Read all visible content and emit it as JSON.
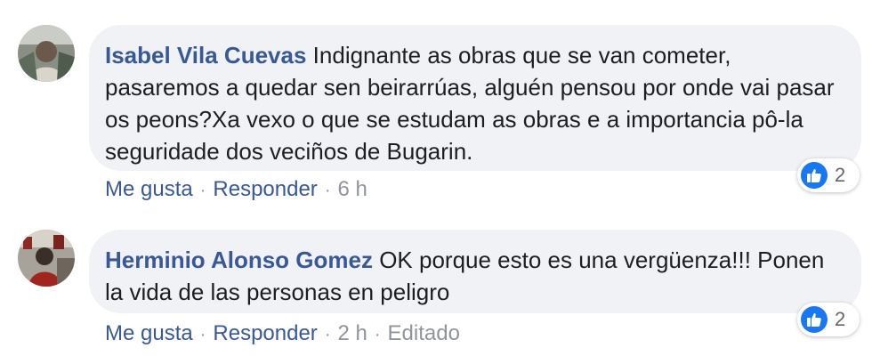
{
  "colors": {
    "author": "#385898",
    "bubble_bg": "#f0f2f5",
    "like_blue": "#1877f2",
    "meta_gray": "#65676b"
  },
  "comments": [
    {
      "author": "Isabel Vila Cuevas",
      "text": "Indignante as obras que se van cometer, pasaremos a quedar sen beirarrúas, alguén pensou por onde vai pasar os peons?Xa vexo o que se estudam as obras e a importancia pô-la seguridade dos veciños de Bugarin.",
      "reaction_icon": "like-icon",
      "reaction_count": "2",
      "like_label": "Me gusta",
      "reply_label": "Responder",
      "separator": "·",
      "time": "6 h",
      "edited": ""
    },
    {
      "author": "Herminio Alonso Gomez",
      "text": "OK porque esto es una vergüenza!!! Ponen la vida de las personas en peligro",
      "reaction_icon": "like-icon",
      "reaction_count": "2",
      "like_label": "Me gusta",
      "reply_label": "Responder",
      "separator": "·",
      "time": "2 h",
      "edited": "Editado"
    }
  ]
}
